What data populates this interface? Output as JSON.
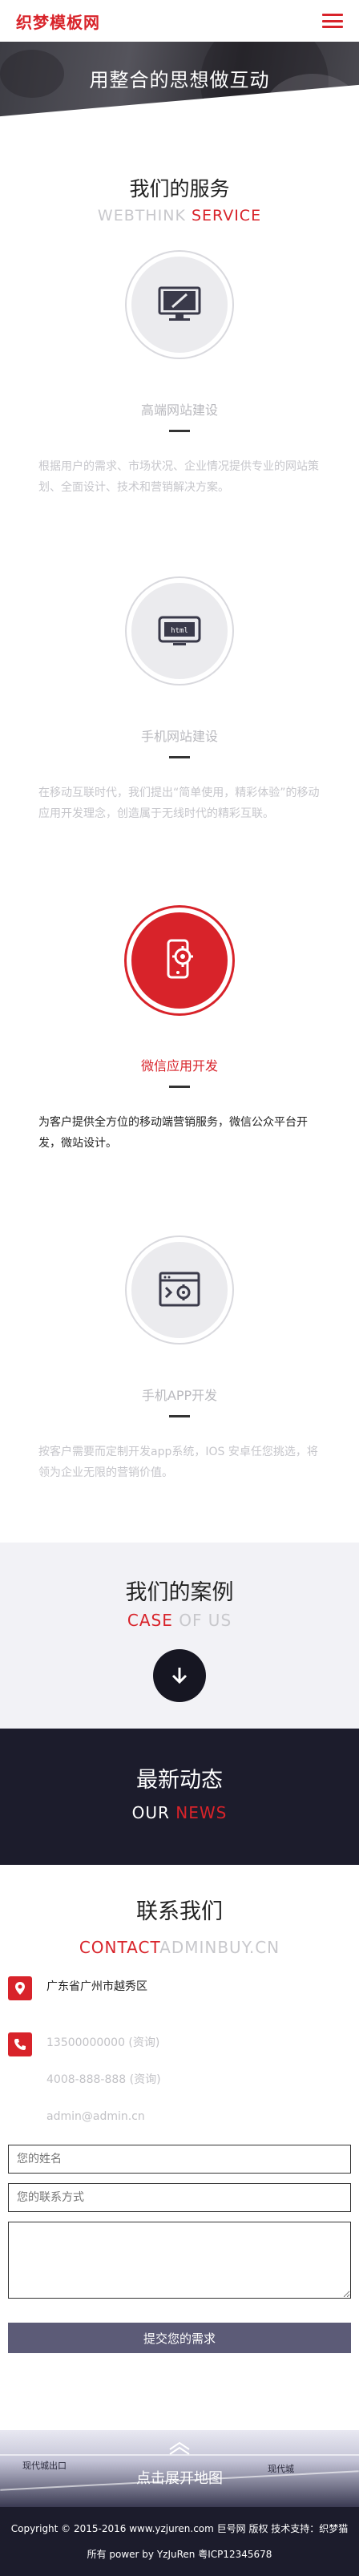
{
  "header": {
    "logo": "织梦模板网"
  },
  "hero": {
    "title": "用整合的思想做互动"
  },
  "services": {
    "title": "我们的服务",
    "sub_light": "WEBTHINK ",
    "sub_red": "SERVICE",
    "items": [
      {
        "icon": "monitor-pen-icon",
        "name": "高端网站建设",
        "desc": "根据用户的需求、市场状况、企业情况提供专业的网站策划、全面设计、技术和营销解决方案。"
      },
      {
        "icon": "html-device-icon",
        "name": "手机网站建设",
        "desc": "在移动互联时代，我们提出“简单使用，精彩体验”的移动应用开发理念，创造属于无线时代的精彩互联。"
      },
      {
        "icon": "phone-gear-icon",
        "name": "微信应用开发",
        "desc": "为客户提供全方位的移动端营销服务，微信公众平台开发，微站设计。"
      },
      {
        "icon": "browser-gear-icon",
        "name": "手机APP开发",
        "desc": "按客户需要而定制开发app系统，IOS 安卓任您挑选，将领为企业无限的营销价值。"
      }
    ]
  },
  "cases": {
    "title": "我们的案例",
    "sub_red": "CASE",
    "sub_light": " OF US"
  },
  "news": {
    "title": "最新动态",
    "sub_white": "OUR ",
    "sub_red": "NEWS"
  },
  "contact": {
    "title": "联系我们",
    "sub_red": "CONTACT",
    "sub_light": "ADMINBUY.CN",
    "address": "广东省广州市越秀区",
    "phone1": "13500000000 (资询)",
    "phone2": "4008-888-888 (资询)",
    "email": "admin@admin.cn"
  },
  "form": {
    "name_placeholder": "您的姓名",
    "contact_placeholder": "您的联系方式",
    "message_placeholder": "",
    "submit_label": "提交您的需求"
  },
  "map": {
    "toggle_label": "点击展开地图",
    "label_left": "现代城出口",
    "label_right": "现代城"
  },
  "footer": {
    "line1": "Copyright © 2015-2016 www.yzjuren.com 巨号网 版权  技术支持：织梦猫",
    "line2": "所有 power by YzJuRen   粤ICP12345678"
  },
  "colors": {
    "accent": "#d8232a",
    "dark": "#1c1c2c",
    "button": "#5c5b77"
  }
}
